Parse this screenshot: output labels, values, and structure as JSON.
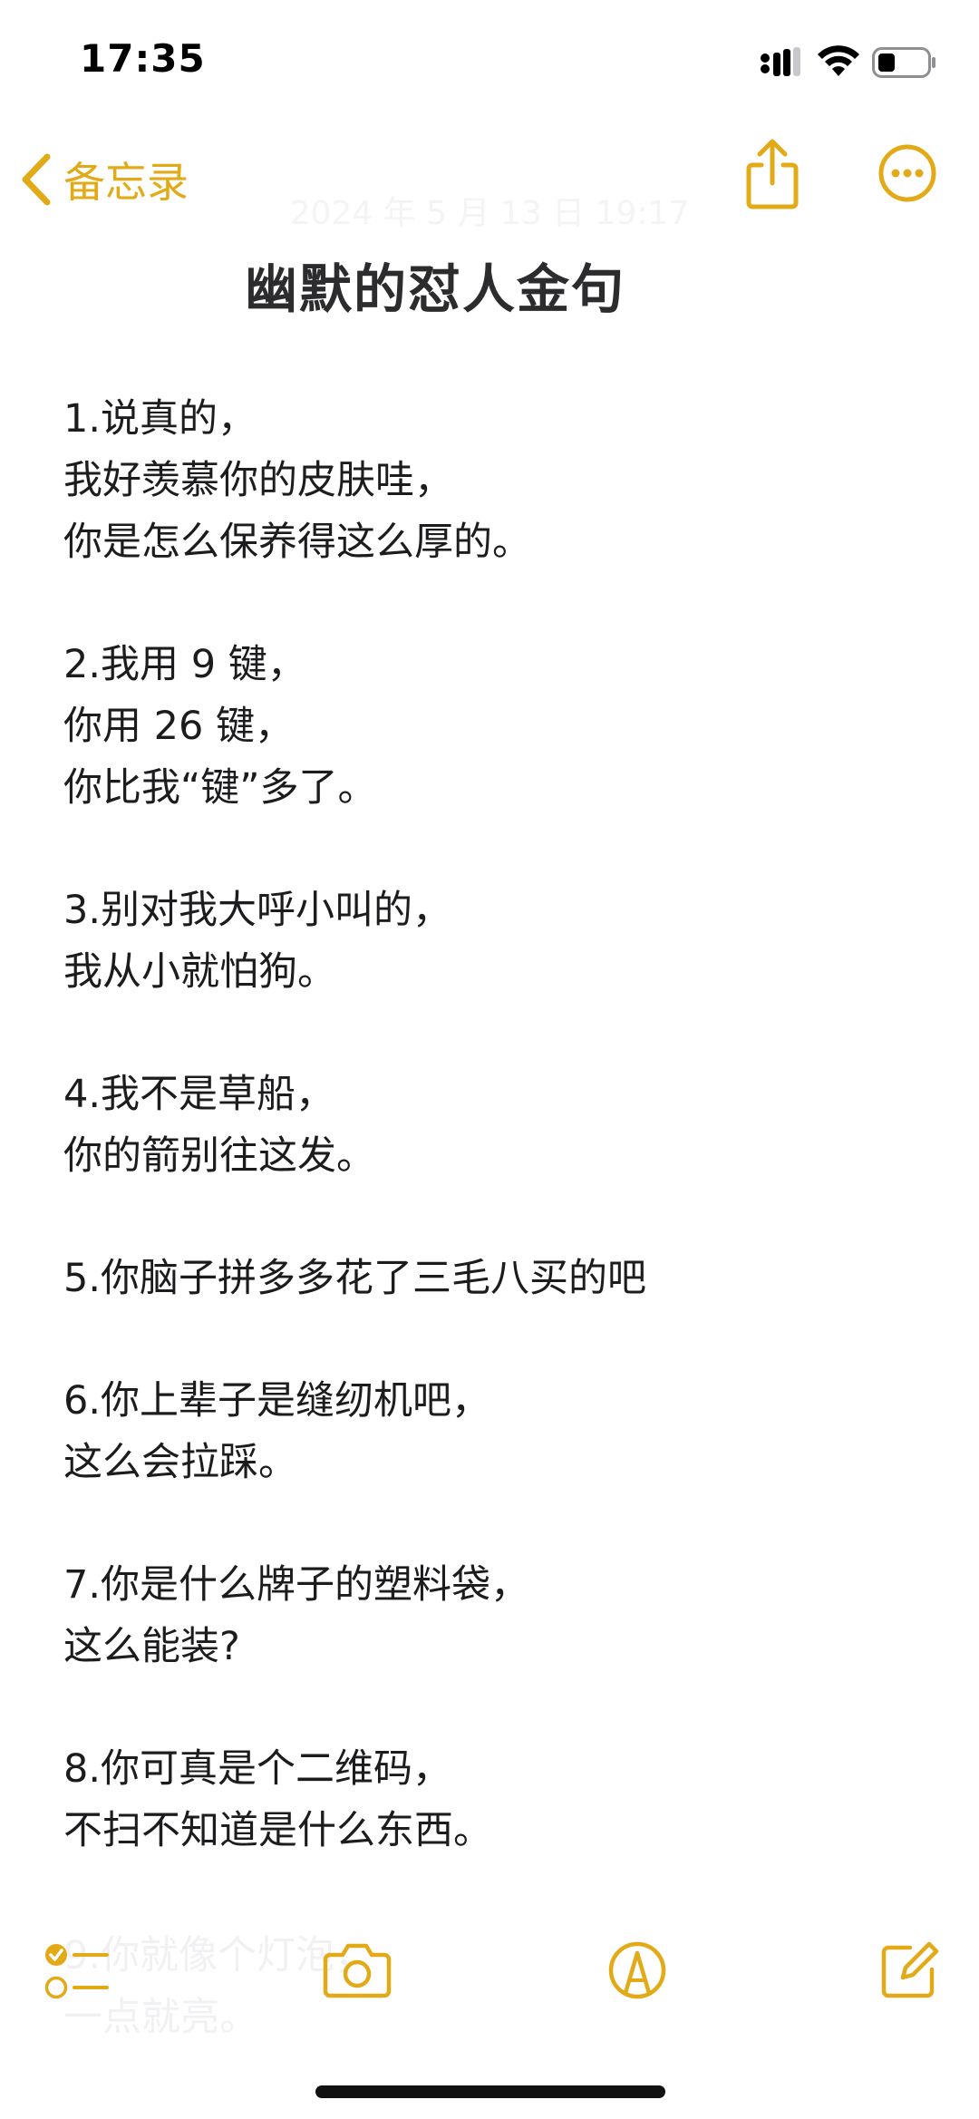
{
  "status_bar": {
    "time": "17:35"
  },
  "nav": {
    "back_label": "备忘录",
    "date_text": "2024 年 5 月 13 日 19:17"
  },
  "note": {
    "title": "幽默的怼人金句",
    "items": [
      {
        "lines": [
          "1.说真的，",
          "我好羡慕你的皮肤哇，",
          "你是怎么保养得这么厚的。"
        ]
      },
      {
        "lines": [
          "2.我用 9 键，",
          "你用 26 键，",
          "你比我“键”多了。"
        ]
      },
      {
        "lines": [
          "3.别对我大呼小叫的，",
          "我从小就怕狗。"
        ]
      },
      {
        "lines": [
          "4.我不是草船，",
          "你的箭别往这发。"
        ]
      },
      {
        "lines": [
          "5.你脑子拼多多花了三毛八买的吧"
        ]
      },
      {
        "lines": [
          "6.你上辈子是缝纫机吧，",
          "这么会拉踩。"
        ]
      },
      {
        "lines": [
          "7.你是什么牌子的塑料袋，",
          "这么能装?"
        ]
      },
      {
        "lines": [
          "8.你可真是个二维码，",
          "不扫不知道是什么东西。"
        ]
      }
    ],
    "faded_lines": [
      "9.你就像个灯泡，",
      "一点就亮。"
    ]
  },
  "colors": {
    "accent": "#e3aa17",
    "text": "#1c1c1e",
    "title": "#2c2c2e"
  },
  "icons": {
    "back": "chevron-left-icon",
    "share": "share-icon",
    "more": "more-icon",
    "checklist": "checklist-icon",
    "camera": "camera-icon",
    "markup": "markup-pen-icon",
    "compose": "compose-icon"
  }
}
